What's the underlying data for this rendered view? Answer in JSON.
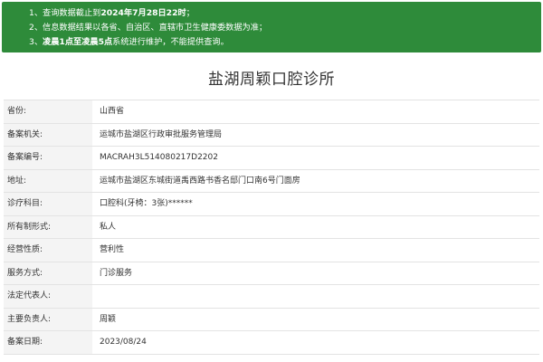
{
  "notice": {
    "line1_prefix": "1、查询数据截止到",
    "line1_bold": "2024年7月28日22时",
    "line1_suffix": "；",
    "line2": "2、信息数据结果以各省、自治区、直辖市卫生健康委数据为准；",
    "line3_prefix": "3、",
    "line3_bold": "凌晨1点至凌晨5点",
    "line3_suffix": "系统进行维护，不能提供查询。"
  },
  "title": "盐湖周颖口腔诊所",
  "rows": [
    {
      "label": "省份:",
      "value": "山西省"
    },
    {
      "label": "备案机关:",
      "value": "运城市盐湖区行政审批服务管理局"
    },
    {
      "label": "备案编号:",
      "value": "MACRAH3L514080217D2202"
    },
    {
      "label": "地址:",
      "value": "运城市盐湖区东城街道禹西路书香名邸门口南6号门面房"
    },
    {
      "label": "诊疗科目:",
      "value": "口腔科(牙椅：3张)******"
    },
    {
      "label": "所有制形式:",
      "value": "私人"
    },
    {
      "label": "经营性质:",
      "value": "营利性"
    },
    {
      "label": "服务方式:",
      "value": "门诊服务"
    },
    {
      "label": "法定代表人:",
      "value": ""
    },
    {
      "label": "主要负责人:",
      "value": "周颖"
    },
    {
      "label": "备案日期:",
      "value": "2023/08/24"
    }
  ],
  "colors": {
    "notice_bg": "#2e8b3a",
    "label_bg": "#f4f4f4",
    "border": "#e3e3e3"
  }
}
